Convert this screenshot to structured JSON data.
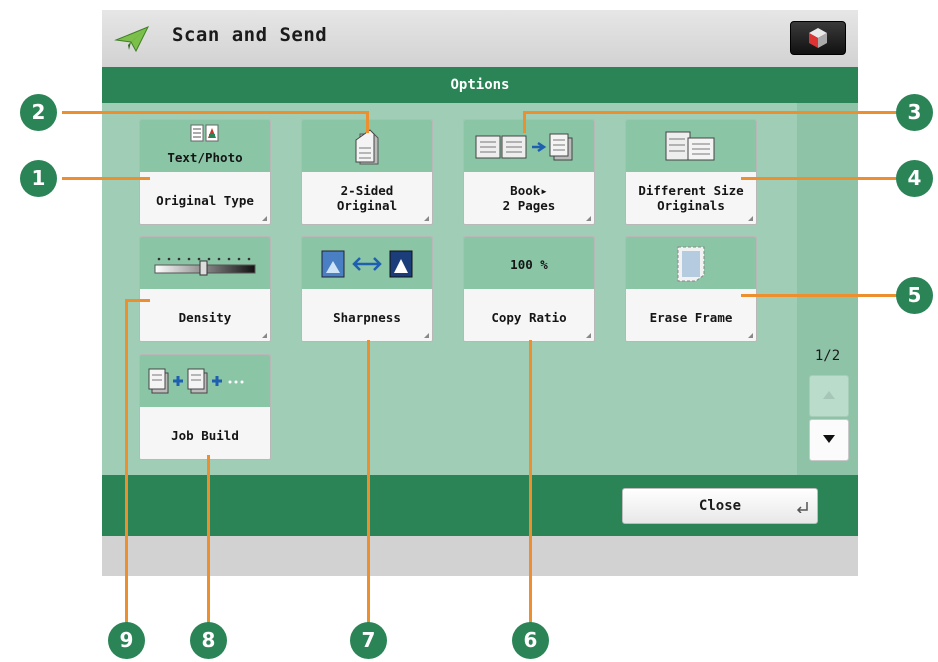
{
  "window": {
    "title": "Scan and Send",
    "app_icon": "paper-plane-icon",
    "menu_icon": "cube-menu-icon"
  },
  "options": {
    "header": "Options",
    "tiles": [
      {
        "id": "original-type",
        "top_text": "Text/Photo",
        "label": "Original Type",
        "icon": "text-photo-icon"
      },
      {
        "id": "two-sided-original",
        "label": "2-Sided\nOriginal",
        "icon": "two-sided-page-icon"
      },
      {
        "id": "book-to-2-pages",
        "label": "Book▸\n2 Pages",
        "icon": "book-to-pages-icon"
      },
      {
        "id": "different-size-originals",
        "label": "Different Size\nOriginals",
        "icon": "mixed-size-originals-icon"
      },
      {
        "id": "density",
        "label": "Density",
        "icon": "density-slider-icon"
      },
      {
        "id": "sharpness",
        "label": "Sharpness",
        "icon": "sharpness-icon"
      },
      {
        "id": "copy-ratio",
        "top_text": "100 %",
        "label": "Copy Ratio"
      },
      {
        "id": "erase-frame",
        "label": "Erase Frame",
        "icon": "erase-frame-icon"
      },
      {
        "id": "job-build",
        "label": "Job Build",
        "icon": "job-build-icon"
      }
    ]
  },
  "pagination": {
    "indicator": "1/2",
    "up_icon": "scroll-up-icon",
    "down_icon": "scroll-down-icon"
  },
  "footer": {
    "close_label": "Close",
    "close_icon": "return-arrow-icon"
  },
  "callouts": [
    "1",
    "2",
    "3",
    "4",
    "5",
    "6",
    "7",
    "8",
    "9"
  ],
  "colors": {
    "header_green": "#2a8456",
    "panel_green": "#9fcdb5",
    "tile_top": "#8ac5a6",
    "leader_orange": "#ee8f2f"
  }
}
